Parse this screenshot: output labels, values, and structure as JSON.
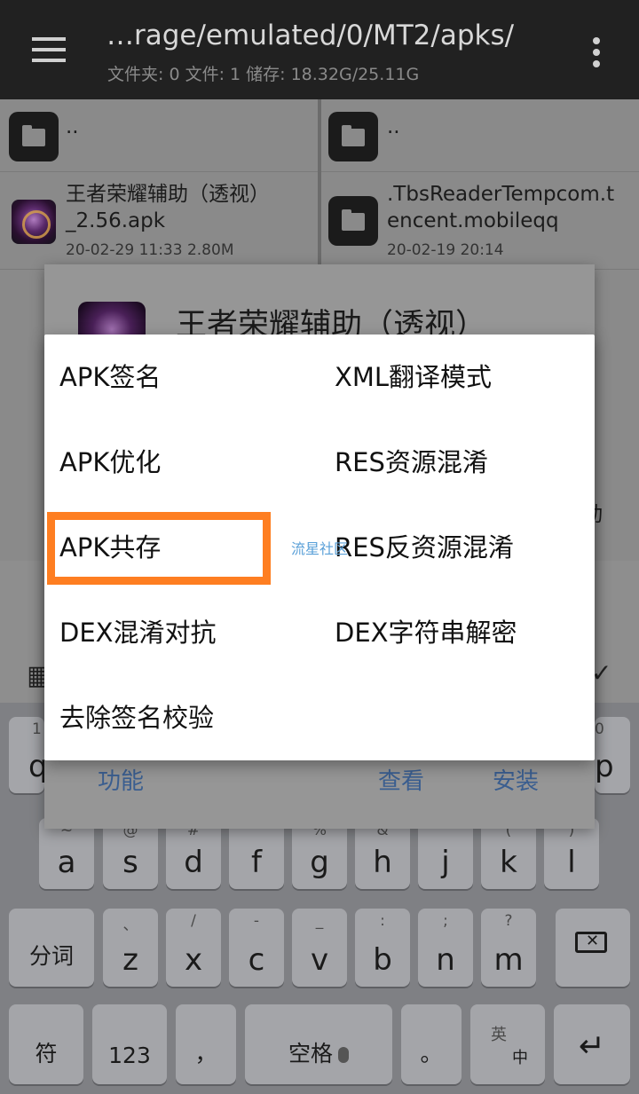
{
  "appbar": {
    "path": "…rage/emulated/0/MT2/apks/",
    "info": "文件夹: 0  文件: 1  储存: 18.32G/25.11G"
  },
  "left_pane": {
    "parent": "..",
    "file": {
      "name_line1": "王者荣耀辅助（透视）",
      "name_line2": "_2.56.apk",
      "meta": "20-02-29 11:33  2.80M"
    }
  },
  "right_pane": {
    "parent": "..",
    "folder": {
      "name_line1": ".TbsReaderTempcom.t",
      "name_line2": "encent.mobileqq",
      "meta": "20-02-19 20:14"
    }
  },
  "back_dialog": {
    "title": "王者荣耀辅助（透视）",
    "partial_text": "动",
    "buttons": {
      "function": "功能",
      "view": "查看",
      "install": "安装"
    }
  },
  "menu": {
    "left": [
      "APK签名",
      "APK优化",
      "APK共存",
      "DEX混淆对抗",
      "去除签名校验"
    ],
    "right": [
      "XML翻译模式",
      "RES资源混淆",
      "RES反资源混淆",
      "DEX字符串解密"
    ],
    "watermark": "流星社区",
    "highlight_color": "#fe7e21"
  },
  "keyboard": {
    "row1_subs": [
      "1",
      "0"
    ],
    "row1_keys": [
      "q",
      "p"
    ],
    "row2": [
      {
        "main": "a",
        "sub": "~"
      },
      {
        "main": "s",
        "sub": "@"
      },
      {
        "main": "d",
        "sub": "#"
      },
      {
        "main": "f",
        "sub": ""
      },
      {
        "main": "g",
        "sub": "%"
      },
      {
        "main": "h",
        "sub": "&"
      },
      {
        "main": "j",
        "sub": ""
      },
      {
        "main": "k",
        "sub": "("
      },
      {
        "main": "l",
        "sub": ")"
      }
    ],
    "row3_left": "分词",
    "row3": [
      {
        "main": "z",
        "sub": "、"
      },
      {
        "main": "x",
        "sub": "/"
      },
      {
        "main": "c",
        "sub": "-"
      },
      {
        "main": "v",
        "sub": "_"
      },
      {
        "main": "b",
        "sub": ":"
      },
      {
        "main": "n",
        "sub": ";"
      },
      {
        "main": "m",
        "sub": "?"
      }
    ],
    "row4": {
      "symbols": "符",
      "num": "123",
      "comma": "，",
      "space": "空格",
      "period": "。",
      "lang_top": "英",
      "lang_bottom": "中"
    }
  }
}
